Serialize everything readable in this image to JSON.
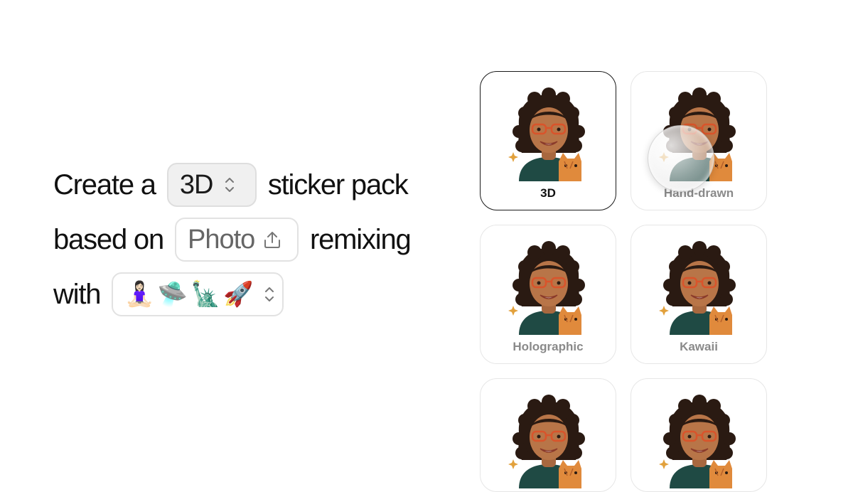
{
  "sentence": {
    "line1": {
      "prefix": "Create a",
      "style_value": "3D",
      "suffix": "sticker pack"
    },
    "line2": {
      "prefix": "based on",
      "source_value": "Photo",
      "suffix": "remixing"
    },
    "line3": {
      "prefix": "with",
      "emojis": [
        "🧘🏻‍♀️",
        "🛸",
        "🗽",
        "🚀"
      ]
    }
  },
  "icons": {
    "style_picker": "chevron-up-down-icon",
    "source_picker": "upload-icon",
    "emoji_picker": "chevron-up-down-icon"
  },
  "styles": [
    {
      "label": "3D",
      "selected": true
    },
    {
      "label": "Hand-drawn",
      "selected": false
    },
    {
      "label": "Holographic",
      "selected": false
    },
    {
      "label": "Kawaii",
      "selected": false
    },
    {
      "label": "",
      "selected": false
    },
    {
      "label": "",
      "selected": false
    }
  ],
  "colors": {
    "text": "#111111",
    "muted_label": "#8a8a8a",
    "card_border": "#e6e6e6",
    "selected_border": "#1a1a1a",
    "pill_fill": "#f0f0f0"
  }
}
